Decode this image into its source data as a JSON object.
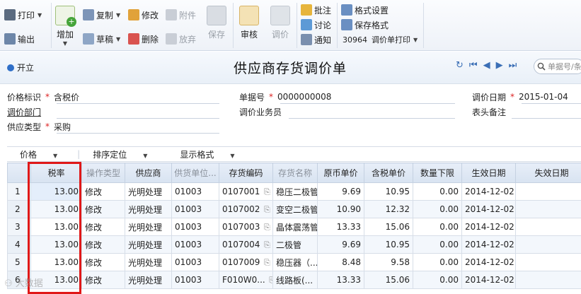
{
  "toolbar": {
    "print": "打印",
    "export": "输出",
    "add": "增加",
    "copy": "复制",
    "draft": "草稿",
    "modify": "修改",
    "delete": "删除",
    "attachment": "附件",
    "abandon": "放弃",
    "save": "保存",
    "audit": "审核",
    "adjust": "调价",
    "annotate": "批注",
    "discuss": "讨论",
    "notify": "通知",
    "format_settings": "格式设置",
    "save_format": "保存格式",
    "print_template_code": "30964",
    "print_template_name": "调价单打印"
  },
  "header": {
    "status": "开立",
    "title": "供应商存货调价单",
    "search_placeholder": "单据号/条码"
  },
  "form": {
    "price_flag_label": "价格标识",
    "price_flag_value": "含税价",
    "doc_no_label": "单据号",
    "doc_no_value": "0000000008",
    "adjust_date_label": "调价日期",
    "adjust_date_value": "2015-01-04",
    "dept_label": "调价部门",
    "clerk_label": "调价业务员",
    "remark_label": "表头备注",
    "supply_type_label": "供应类型",
    "supply_type_value": "采购"
  },
  "grid_toolbar": {
    "price": "价格",
    "sort": "排序定位",
    "display": "显示格式"
  },
  "table": {
    "columns": [
      "",
      "税率",
      "操作类型",
      "供应商",
      "供货单位...",
      "存货编码",
      "存货名称",
      "原币单价",
      "含税单价",
      "数量下限",
      "生效日期",
      "失效日期"
    ],
    "rows": [
      [
        "1",
        "13.00",
        "修改",
        "光明处理",
        "01003",
        "0107001",
        "稳压二极管",
        "9.69",
        "10.95",
        "0.00",
        "2014-12-02",
        ""
      ],
      [
        "2",
        "13.00",
        "修改",
        "光明处理",
        "01003",
        "0107002",
        "变空二极管",
        "10.90",
        "12.32",
        "0.00",
        "2014-12-02",
        ""
      ],
      [
        "3",
        "13.00",
        "修改",
        "光明处理",
        "01003",
        "0107003",
        "晶体震荡管",
        "13.33",
        "15.06",
        "0.00",
        "2014-12-02",
        ""
      ],
      [
        "4",
        "13.00",
        "修改",
        "光明处理",
        "01003",
        "0107004",
        "二极管",
        "9.69",
        "10.95",
        "0.00",
        "2014-12-02",
        ""
      ],
      [
        "5",
        "13.00",
        "修改",
        "光明处理",
        "01003",
        "0107009",
        "稳压器（...",
        "8.48",
        "9.58",
        "0.00",
        "2014-12-02",
        ""
      ],
      [
        "6",
        "13.00",
        "修改",
        "光明处理",
        "01003",
        "F010W0...",
        "线路板(...",
        "13.33",
        "15.06",
        "0.00",
        "2014-12-02",
        ""
      ]
    ]
  },
  "watermark": "大数据"
}
